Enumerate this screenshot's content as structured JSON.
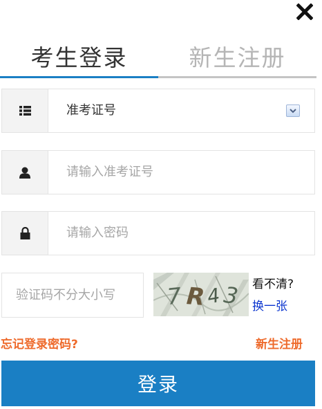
{
  "close": {
    "icon": "close-icon"
  },
  "tabs": [
    {
      "label": "考生登录",
      "active": true
    },
    {
      "label": "新生注册",
      "active": false
    }
  ],
  "form": {
    "id_type": {
      "icon": "list-icon",
      "selected_value": "准考证号"
    },
    "ticket_number": {
      "icon": "user-icon",
      "placeholder": "请输入准考证号"
    },
    "password": {
      "icon": "lock-icon",
      "placeholder": "请输入密码"
    },
    "captcha": {
      "placeholder": "验证码不分大小写",
      "image_text": "7R43",
      "unclear_label": "看不清?",
      "change_link": "换一张"
    }
  },
  "links": {
    "forgot_password": "忘记登录密码?",
    "new_register": "新生注册"
  },
  "submit": {
    "label": "登录"
  },
  "colors": {
    "accent": "#1a7fc4",
    "link_orange": "#ee6a2b",
    "link_blue": "#0b35cf"
  }
}
